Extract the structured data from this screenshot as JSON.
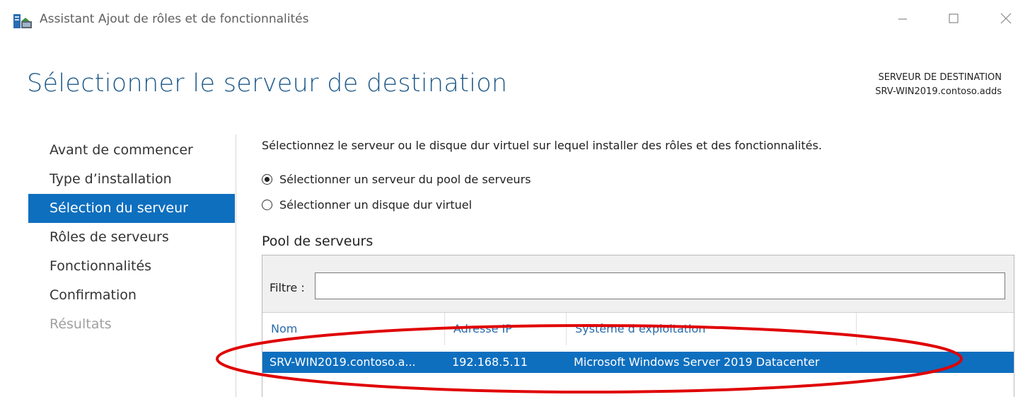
{
  "window": {
    "title": "Assistant Ajout de rôles et de fonctionnalités"
  },
  "header": {
    "page_title": "Sélectionner le serveur de destination",
    "destination_label": "SERVEUR DE DESTINATION",
    "destination_value": "SRV-WIN2019.contoso.adds"
  },
  "nav": {
    "items": [
      {
        "label": "Avant de commencer",
        "state": "normal"
      },
      {
        "label": "Type d’installation",
        "state": "normal"
      },
      {
        "label": "Sélection du serveur",
        "state": "active"
      },
      {
        "label": "Rôles de serveurs",
        "state": "normal"
      },
      {
        "label": "Fonctionnalités",
        "state": "normal"
      },
      {
        "label": "Confirmation",
        "state": "normal"
      },
      {
        "label": "Résultats",
        "state": "disabled"
      }
    ]
  },
  "main": {
    "description": "Sélectionnez le serveur ou le disque dur virtuel sur lequel installer des rôles et des fonctionnalités.",
    "radio_pool": "Sélectionner un serveur du pool de serveurs",
    "radio_vhd": "Sélectionner un disque dur virtuel",
    "pool_label": "Pool de serveurs",
    "filter_label": "Filtre :",
    "filter_value": "",
    "columns": [
      "Nom",
      "Adresse IP",
      "Système d’exploitation"
    ],
    "rows": [
      {
        "name": "SRV-WIN2019.contoso.a...",
        "ip": "192.168.5.11",
        "os": "Microsoft Windows Server 2019 Datacenter"
      }
    ]
  },
  "colors": {
    "accent": "#0e6fbf",
    "title": "#1f5a8a",
    "annotation": "#e00000"
  },
  "icons": {
    "app": "server-manager-icon",
    "minimize": "minimize-icon",
    "maximize": "maximize-icon",
    "close": "close-icon"
  }
}
